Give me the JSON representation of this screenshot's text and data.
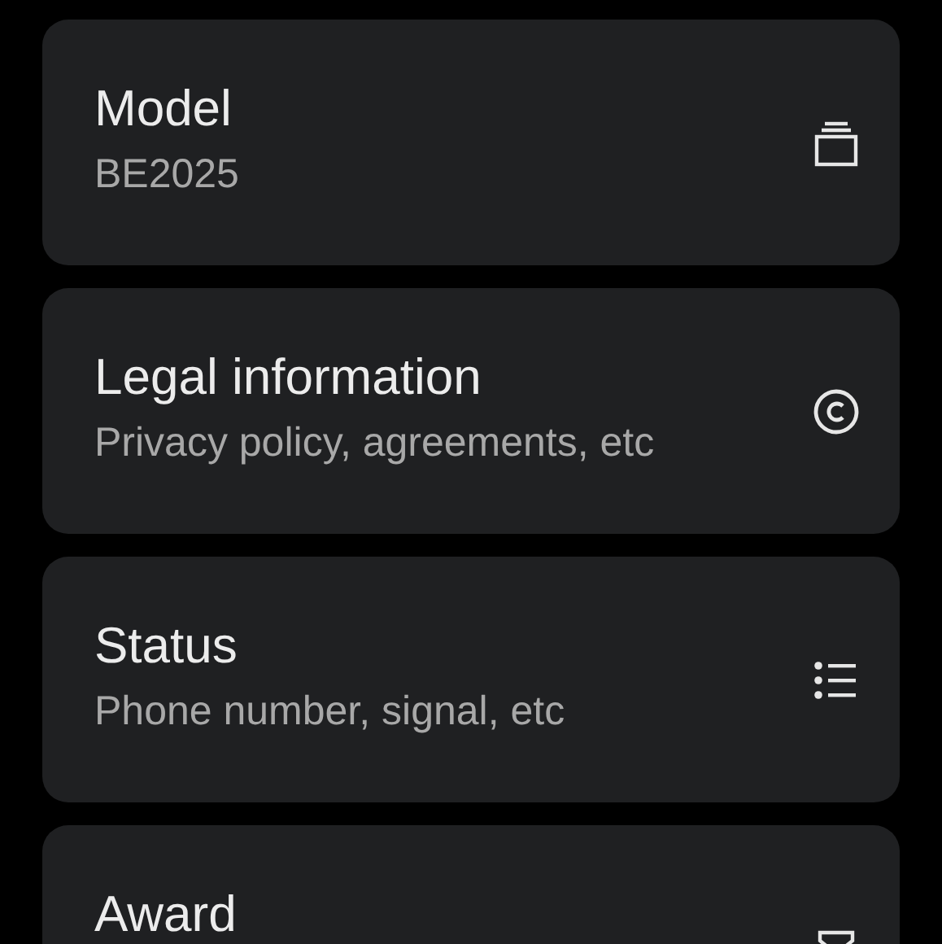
{
  "items": [
    {
      "title": "Model",
      "subtitle": "BE2025",
      "kind": "stack"
    },
    {
      "title": "Legal information",
      "subtitle": "Privacy policy, agreements, etc",
      "kind": "copyright"
    },
    {
      "title": "Status",
      "subtitle": "Phone number, signal, etc",
      "kind": "list"
    },
    {
      "title": "Award",
      "kind": "award"
    }
  ]
}
